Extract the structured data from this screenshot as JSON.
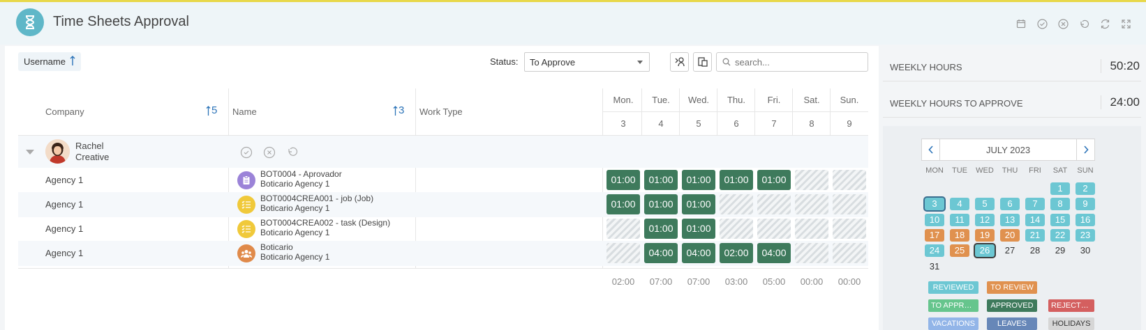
{
  "app": {
    "title": "Time Sheets Approval"
  },
  "header_icons": [
    "calendar-icon",
    "check-circle-icon",
    "close-circle-icon",
    "undo-icon",
    "refresh-icon",
    "expand-icon"
  ],
  "toolbar": {
    "username_label": "Username",
    "status_label": "Status:",
    "status_value": "To Approve",
    "search_placeholder": "search..."
  },
  "table": {
    "headers": {
      "company": "Company",
      "name": "Name",
      "work_type": "Work Type",
      "company_sort": "5",
      "name_sort": "3"
    },
    "days": [
      {
        "name": "Mon.",
        "num": "3"
      },
      {
        "name": "Tue.",
        "num": "4"
      },
      {
        "name": "Wed.",
        "num": "5"
      },
      {
        "name": "Thu.",
        "num": "6"
      },
      {
        "name": "Fri.",
        "num": "7"
      },
      {
        "name": "Sat.",
        "num": "8"
      },
      {
        "name": "Sun.",
        "num": "9"
      }
    ],
    "group": {
      "first": "Rachel",
      "last": "Creative"
    },
    "rows": [
      {
        "company": "Agency 1",
        "task": "BOT0004 - Aprovador",
        "sub": "Boticario   Agency 1",
        "icon": "clipboard-icon",
        "color": "#9b83d8",
        "cells": [
          "01:00",
          "01:00",
          "01:00",
          "01:00",
          "01:00",
          "",
          ""
        ]
      },
      {
        "company": "Agency 1",
        "task": "BOT0004CREA001 - job (Job)",
        "sub": "Boticario   Agency 1",
        "icon": "list-icon",
        "color": "#f0c93a",
        "cells": [
          "01:00",
          "01:00",
          "01:00",
          "",
          "",
          "",
          ""
        ]
      },
      {
        "company": "Agency 1",
        "task": "BOT0004CREA002 - task (Design)",
        "sub": "Boticario   Agency 1",
        "icon": "list-icon",
        "color": "#f0c93a",
        "cells": [
          "",
          "01:00",
          "01:00",
          "",
          "",
          "",
          ""
        ]
      },
      {
        "company": "Agency 1",
        "task": "Boticario",
        "sub": "Boticario   Agency 1",
        "icon": "people-icon",
        "color": "#e08a4a",
        "cells": [
          "",
          "04:00",
          "04:00",
          "02:00",
          "04:00",
          "",
          ""
        ]
      }
    ],
    "totals": [
      "02:00",
      "07:00",
      "07:00",
      "03:00",
      "05:00",
      "00:00",
      "00:00"
    ]
  },
  "summary": {
    "weekly_hours_label": "WEEKLY HOURS",
    "weekly_hours": "50:20",
    "to_approve_label": "WEEKLY HOURS TO APPROVE",
    "to_approve": "24:00"
  },
  "calendar": {
    "month": "JULY 2023",
    "weekdays": [
      "MON",
      "TUE",
      "WED",
      "THU",
      "FRI",
      "SAT",
      "SUN"
    ],
    "weeks": [
      [
        null,
        null,
        null,
        null,
        null,
        {
          "d": "1",
          "s": "rev"
        },
        {
          "d": "2",
          "s": "rev"
        }
      ],
      [
        {
          "d": "3",
          "s": "rev sel"
        },
        {
          "d": "4",
          "s": "rev"
        },
        {
          "d": "5",
          "s": "rev"
        },
        {
          "d": "6",
          "s": "rev"
        },
        {
          "d": "7",
          "s": "rev"
        },
        {
          "d": "8",
          "s": "rev"
        },
        {
          "d": "9",
          "s": "rev"
        }
      ],
      [
        {
          "d": "10",
          "s": "rev"
        },
        {
          "d": "11",
          "s": "rev"
        },
        {
          "d": "12",
          "s": "rev"
        },
        {
          "d": "13",
          "s": "rev"
        },
        {
          "d": "14",
          "s": "rev"
        },
        {
          "d": "15",
          "s": "rev"
        },
        {
          "d": "16",
          "s": "rev"
        }
      ],
      [
        {
          "d": "17",
          "s": "tor"
        },
        {
          "d": "18",
          "s": "tor"
        },
        {
          "d": "19",
          "s": "tor"
        },
        {
          "d": "20",
          "s": "tor"
        },
        {
          "d": "21",
          "s": "rev"
        },
        {
          "d": "22",
          "s": "rev"
        },
        {
          "d": "23",
          "s": "rev"
        }
      ],
      [
        {
          "d": "24",
          "s": "rev"
        },
        {
          "d": "25",
          "s": "tor"
        },
        {
          "d": "26",
          "s": "rev today"
        },
        {
          "d": "27",
          "s": "plain"
        },
        {
          "d": "28",
          "s": "plain"
        },
        {
          "d": "29",
          "s": "plain"
        },
        {
          "d": "30",
          "s": "plain"
        }
      ],
      [
        {
          "d": "31",
          "s": "plain"
        },
        null,
        null,
        null,
        null,
        null,
        null
      ]
    ],
    "legend": [
      {
        "label": "REVIEWED",
        "color": "#6cc7d3"
      },
      {
        "label": "TO REVIEW",
        "color": "#e0914f"
      },
      {
        "label": "TO APPROVE",
        "color": "#66c58d"
      },
      {
        "label": "APPROVED",
        "color": "#3e7a5c"
      },
      {
        "label": "REJECTED",
        "color": "#d45f5f"
      },
      {
        "label": "VACATIONS",
        "color": "#92b5e8"
      },
      {
        "label": "LEAVES",
        "color": "#6787b8"
      },
      {
        "label": "HOLIDAYS",
        "color": "#d6d6d6"
      }
    ]
  }
}
